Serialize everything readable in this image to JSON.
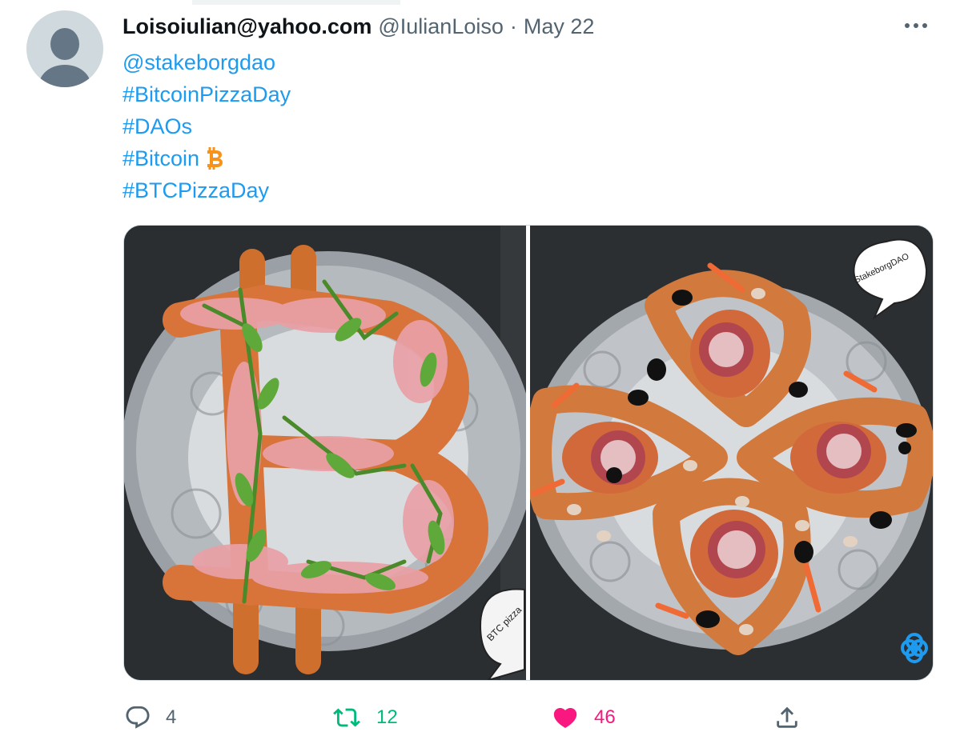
{
  "tweet": {
    "author_name": "Loisoiulian@yahoo.com",
    "author_handle": "@IulianLoiso",
    "separator": "·",
    "date": "May 22",
    "lines": [
      "@stakeborgdao",
      "#BitcoinPizzaDay",
      "#DAOs",
      "#Bitcoin",
      "#BTCPizzaDay"
    ],
    "emoji_after_line_4": "bitcoin-emoji",
    "link_color": "#1d9bf0"
  },
  "media": {
    "left_photo_watermark": "BTC pizza",
    "right_photo_watermark": "StakeborgDAO"
  },
  "actions": {
    "reply_count": "4",
    "retweet_count": "12",
    "like_count": "46",
    "like_color": "#f91880",
    "retweet_color": "#00ba7c"
  },
  "icons": [
    "more-icon",
    "reply-icon",
    "retweet-icon",
    "like-icon",
    "share-icon",
    "bitcoin-emoji-icon",
    "stakeborg-logo-icon"
  ]
}
